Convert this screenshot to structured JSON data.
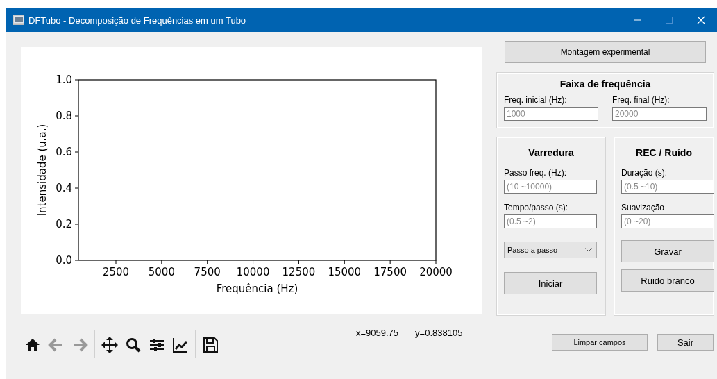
{
  "window": {
    "title": "DFTubo - Decomposição de Frequências em um Tubo",
    "controls": [
      {
        "kind": "minimize",
        "disabled": false
      },
      {
        "kind": "maximize",
        "disabled": true
      },
      {
        "kind": "close",
        "disabled": false
      }
    ]
  },
  "plot": {
    "chart_data": {
      "type": "line",
      "xlabel": "Frequência (Hz)",
      "ylabel": "Intensidade (u.a.)",
      "xlim": [
        450,
        20000
      ],
      "ylim": [
        0,
        1
      ],
      "xticks": [
        2500,
        5000,
        7500,
        10000,
        12500,
        15000,
        17500,
        20000
      ],
      "yticks": [
        {
          "value": 0,
          "label": "0.0"
        },
        {
          "value": 0.2,
          "label": "0.2"
        },
        {
          "value": 0.4,
          "label": "0.4"
        },
        {
          "value": 0.6,
          "label": "0.6"
        },
        {
          "value": 0.8,
          "label": "0.8"
        },
        {
          "value": 1,
          "label": "1.0"
        }
      ]
    }
  },
  "toolbar": {
    "groups": [
      [
        {
          "kind": "home",
          "disabled": false
        },
        {
          "kind": "back",
          "disabled": true
        },
        {
          "kind": "forward",
          "disabled": true
        }
      ],
      [
        {
          "kind": "pan",
          "disabled": false
        },
        {
          "kind": "zoom",
          "disabled": false
        },
        {
          "kind": "configure",
          "disabled": false
        },
        {
          "kind": "axes",
          "disabled": false
        }
      ],
      [
        {
          "kind": "save",
          "disabled": false
        }
      ]
    ],
    "coordinates": [
      "x=9059.75",
      "y=0.838105"
    ]
  },
  "setup_button": "Montagem experimental",
  "frequency_range": {
    "title": "Faixa de frequência",
    "fields": [
      {
        "label": "Freq. inicial (Hz):",
        "placeholder": "1000"
      },
      {
        "label": "Freq. final (Hz):",
        "placeholder": "20000"
      }
    ]
  },
  "sweep": {
    "title": "Varredura",
    "fields": [
      {
        "label": "Passo freq. (Hz):",
        "placeholder": "(10 ~10000)"
      },
      {
        "label": "Tempo/passo (s):",
        "placeholder": "(0.5 ~2)"
      }
    ],
    "mode_dropdown": "Passo a passo",
    "button": "Iniciar"
  },
  "recording": {
    "title": "REC / Ruído",
    "fields": [
      {
        "label": "Duração (s):",
        "placeholder": "(0.5 ~10)"
      },
      {
        "label": "Suavização",
        "placeholder": "(0 ~20)"
      }
    ],
    "buttons": [
      "Gravar",
      "Ruido branco"
    ]
  },
  "footer_buttons": [
    {
      "label": "Limpar campos",
      "kind": "small"
    },
    {
      "label": "Sair",
      "kind": "normal"
    }
  ]
}
